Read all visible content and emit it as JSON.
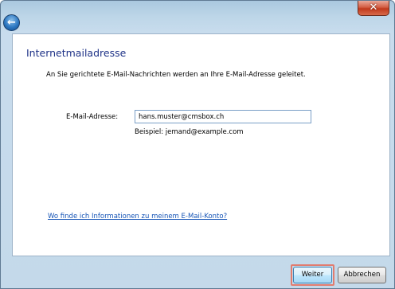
{
  "titlebar": {
    "close_label": "✕",
    "back_label": "←"
  },
  "page": {
    "title": "Internetmailadresse",
    "intro": "An Sie gerichtete E-Mail-Nachrichten werden an Ihre E-Mail-Adresse geleitet."
  },
  "form": {
    "email_label": "E-Mail-Adresse:",
    "email_value": "hans.muster@cmsbox.ch",
    "example": "Beispiel: jemand@example.com"
  },
  "help_link": "Wo finde ich Informationen zu meinem E-Mail-Konto?",
  "footer": {
    "next_label": "Weiter",
    "cancel_label": "Abbrechen"
  },
  "colors": {
    "title": "#1e3287",
    "link": "#1554b6",
    "highlight": "#e27c6f"
  }
}
